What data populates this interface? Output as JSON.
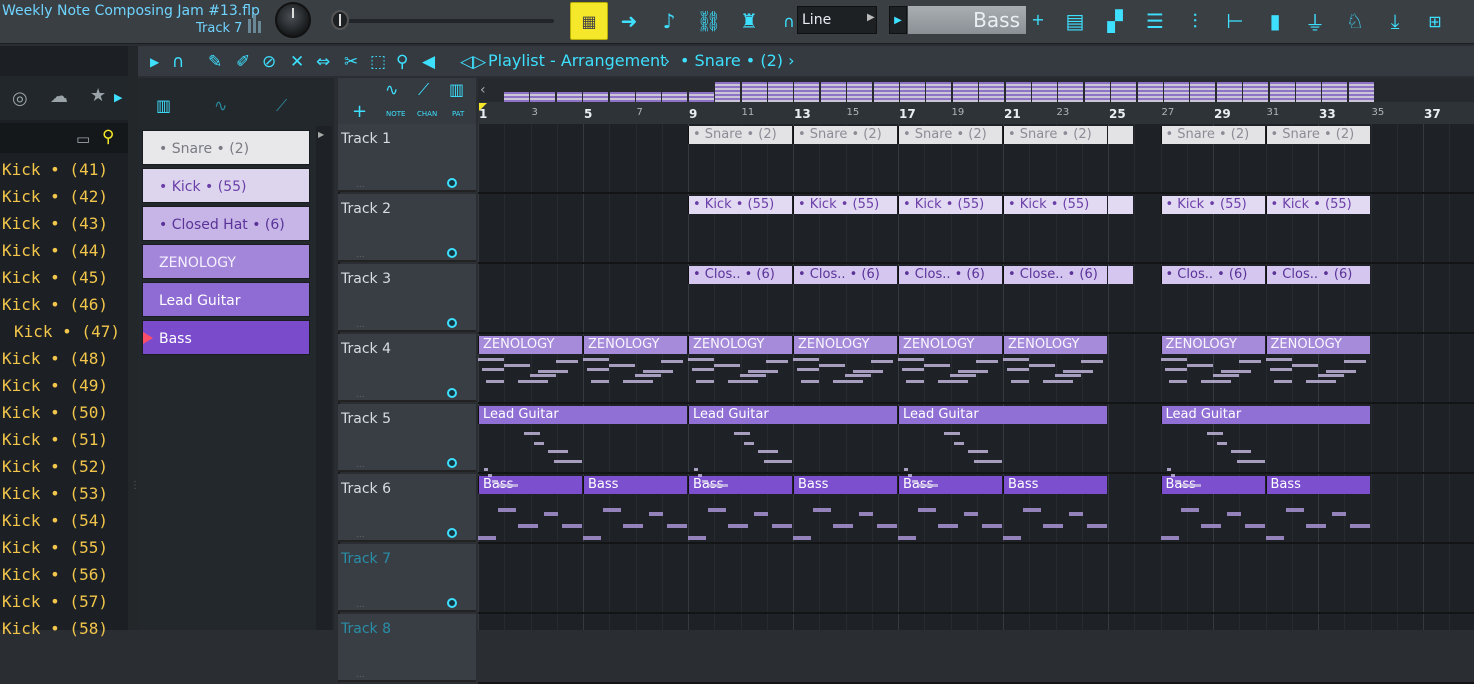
{
  "app": {
    "project_title": "Weekly Note Composing Jam #13.flp",
    "track_label": "Track 7",
    "line_mode": "Line",
    "channel_name": "Bass"
  },
  "toolbar": {
    "playlist_title": "Playlist - Arrangement",
    "selected_pattern": "Snare",
    "selected_count": "(2)",
    "separator1": "›",
    "separator2": "•"
  },
  "head_tabs": {
    "note": "NOTE",
    "chan": "CHAN",
    "pat": "PAT"
  },
  "browser": {
    "items": [
      "Kick  •  (41)",
      "Kick  •  (42)",
      "Kick  •  (43)",
      "Kick  •  (44)",
      "Kick  •  (45)",
      "Kick  •  (46)",
      "Kick  •  (47)",
      "Kick  •  (48)",
      "Kick  •  (49)",
      "Kick  •  (50)",
      "Kick  •  (51)",
      "Kick  •  (52)",
      "Kick  •  (53)",
      "Kick  •  (54)",
      "Kick  •  (55)",
      "Kick  •  (56)",
      "Kick  •  (57)",
      "Kick  •  (58)"
    ]
  },
  "patterns": [
    {
      "label": "•  Snare  •  (2)",
      "color": "#e8e8ea",
      "text": "#7a7a84"
    },
    {
      "label": "•  Kick  •  (55)",
      "color": "#ddd5ee",
      "text": "#6b3fa8"
    },
    {
      "label": "•  Closed Hat  •  (6)",
      "color": "#c6b5e6",
      "text": "#5a3298"
    },
    {
      "label": "ZENOLOGY",
      "color": "#a386d9",
      "text": "#f4f0ff"
    },
    {
      "label": "Lead Guitar",
      "color": "#8f6bd4",
      "text": "#ffffff"
    },
    {
      "label": "Bass",
      "color": "#7a4ccc",
      "text": "#ffffff"
    }
  ],
  "ruler": [
    "1",
    "3",
    "5",
    "7",
    "9",
    "11",
    "13",
    "15",
    "17",
    "19",
    "21",
    "23",
    "25",
    "27",
    "29",
    "31",
    "33",
    "35",
    "37"
  ],
  "tracks": [
    "Track 1",
    "Track 2",
    "Track 3",
    "Track 4",
    "Track 5",
    "Track 6",
    "Track 7",
    "Track 8"
  ],
  "clips": {
    "snare": "•  Snare  •  (2)",
    "kick": "•  Kick  •  (55)",
    "hat1": "•  Clos..  •  (6)",
    "hat2": "•  Close..  •  (6)",
    "zen": "ZENOLOGY",
    "lead": "Lead Guitar",
    "bass": "Bass"
  },
  "colors": {
    "accent": "#3ee0ff",
    "highlight": "#f5e82a",
    "kick_text": "#f3c64b"
  }
}
